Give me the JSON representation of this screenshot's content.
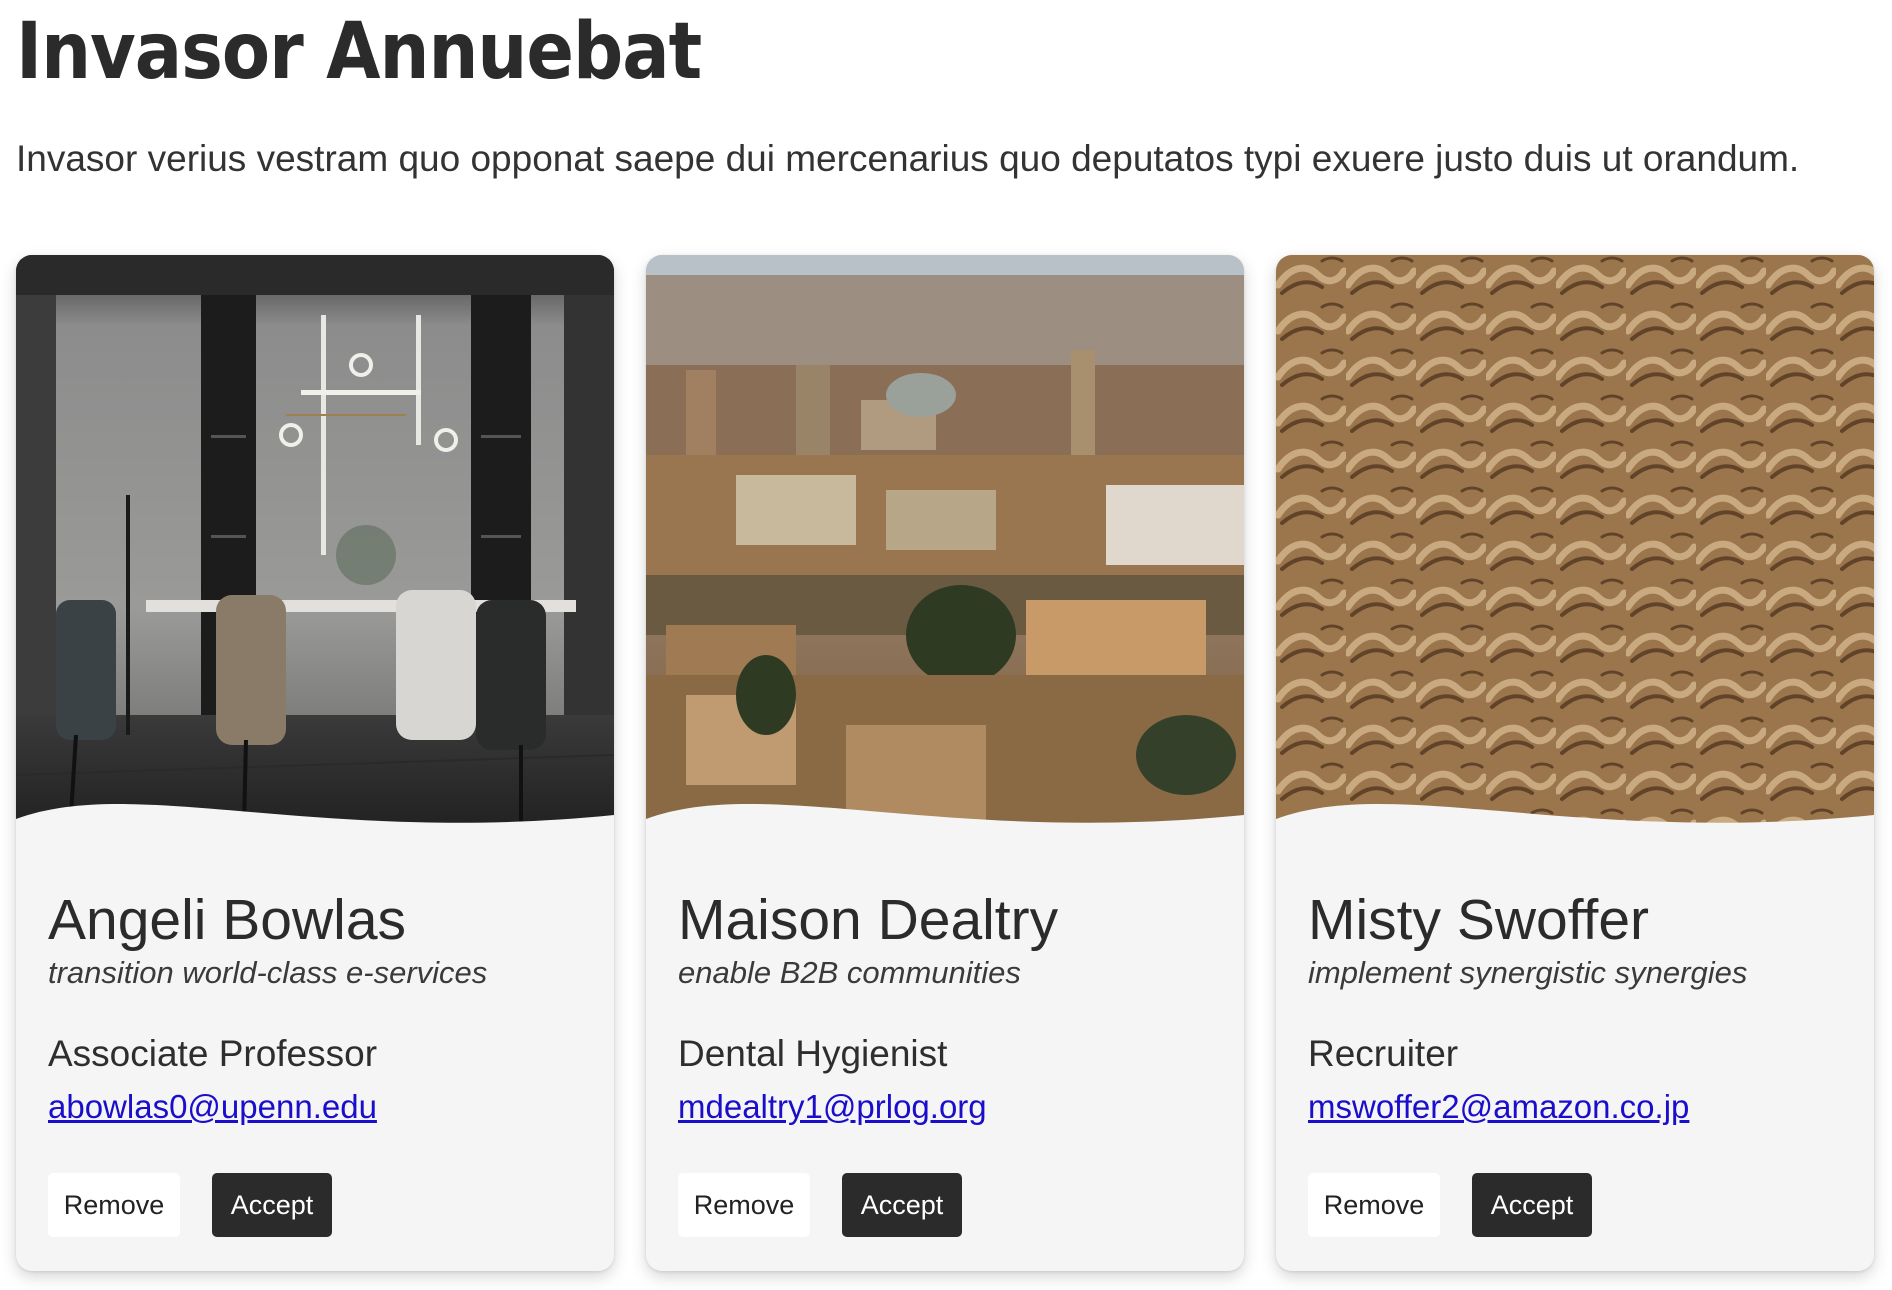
{
  "header": {
    "title": "Invasor Annuebat",
    "description": "Invasor verius vestram quo opponat saepe dui mercenarius quo deputatos typi exuere justo duis ut orandum."
  },
  "cards": [
    {
      "image": "dining-room-photo",
      "name": "Angeli Bowlas",
      "tagline": "transition world-class e-services",
      "role": "Associate Professor",
      "email": "abowlas0@upenn.edu",
      "remove_label": "Remove",
      "accept_label": "Accept"
    },
    {
      "image": "hilltop-city-photo",
      "name": "Maison Dealtry",
      "tagline": "enable B2B communities",
      "role": "Dental Hygienist",
      "email": "mdealtry1@prlog.org",
      "remove_label": "Remove",
      "accept_label": "Accept"
    },
    {
      "image": "sand-texture-photo",
      "name": "Misty Swoffer",
      "tagline": "implement synergistic synergies",
      "role": "Recruiter",
      "email": "mswoffer2@amazon.co.jp",
      "remove_label": "Remove",
      "accept_label": "Accept"
    }
  ],
  "colors": {
    "card_background": "#f5f5f5",
    "accept_button": "#2b2b2b",
    "link": "#1a0dcc"
  }
}
